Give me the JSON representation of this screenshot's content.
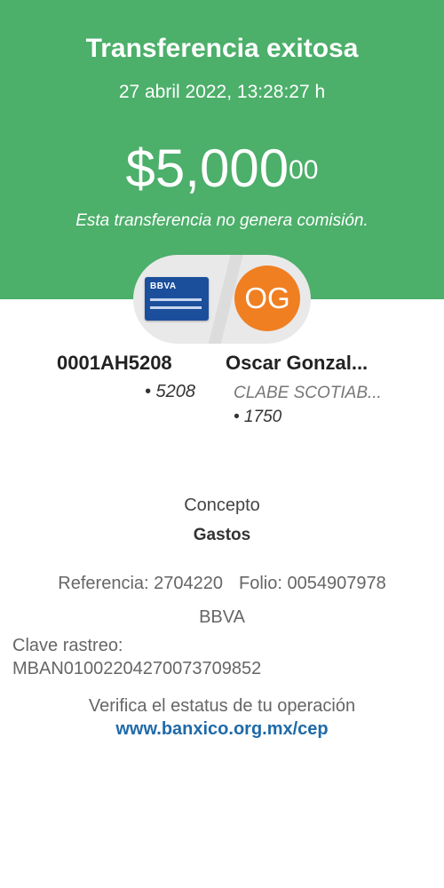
{
  "header": {
    "title": "Transferencia exitosa",
    "datetime": "27 abril 2022, 13:28:27 h",
    "amount_main": "$5,000",
    "amount_cents": "00",
    "note": "Esta transferencia no genera comisión."
  },
  "origin": {
    "card_brand": "BBVA",
    "account": "0001AH5208",
    "last_digits": "• 5208"
  },
  "destination": {
    "avatar_initials": "OG",
    "name": "Oscar Gonzal...",
    "clabe": "CLABE SCOTIAB...",
    "last_digits": "• 1750"
  },
  "details": {
    "concept_label": "Concepto",
    "concept_value": "Gastos",
    "reference": "Referencia: 2704220",
    "folio": "Folio: 0054907978",
    "bank": "BBVA",
    "tracking_label": "Clave rastreo:",
    "tracking_value": "MBAN01002204270073709852",
    "verify_text": "Verifica el estatus de tu operación",
    "verify_link": "www.banxico.org.mx/cep"
  },
  "colors": {
    "header_bg": "#4caf6a",
    "avatar_bg": "#f07f22",
    "card_bg": "#1b4f9c",
    "link": "#1f6aa8"
  }
}
